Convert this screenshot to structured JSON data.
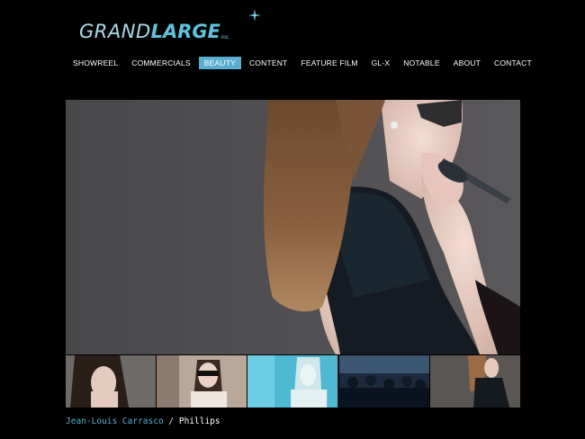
{
  "brand": {
    "name_part1": "GRAND",
    "name_part2": "LARGE",
    "suffix": "inc."
  },
  "nav": {
    "items": [
      {
        "label": "SHOWREEL"
      },
      {
        "label": "COMMERCIALS"
      },
      {
        "label": "BEAUTY",
        "active": true
      },
      {
        "label": "CONTENT"
      },
      {
        "label": "FEATURE FILM"
      },
      {
        "label": "GL-X"
      },
      {
        "label": "NOTABLE"
      },
      {
        "label": "ABOUT"
      },
      {
        "label": "CONTACT"
      }
    ]
  },
  "hero": {
    "image_subject": "woman-with-sunglasses-black-sequin-dress"
  },
  "thumbnails": [
    {
      "subject": "woman-portrait-dark-hair"
    },
    {
      "subject": "woman-with-sunglasses"
    },
    {
      "subject": "blonde-woman-blue-tint"
    },
    {
      "subject": "crowd-scene-blue"
    },
    {
      "subject": "woman-in-black-dress"
    }
  ],
  "caption": {
    "director": "Jean-Louis Carrasco",
    "separator": " / ",
    "client": "Phillips"
  },
  "colors": {
    "accent": "#5aaed0",
    "background": "#000000",
    "logo_light": "#a9dbea",
    "logo_bold": "#5fc3dd"
  }
}
